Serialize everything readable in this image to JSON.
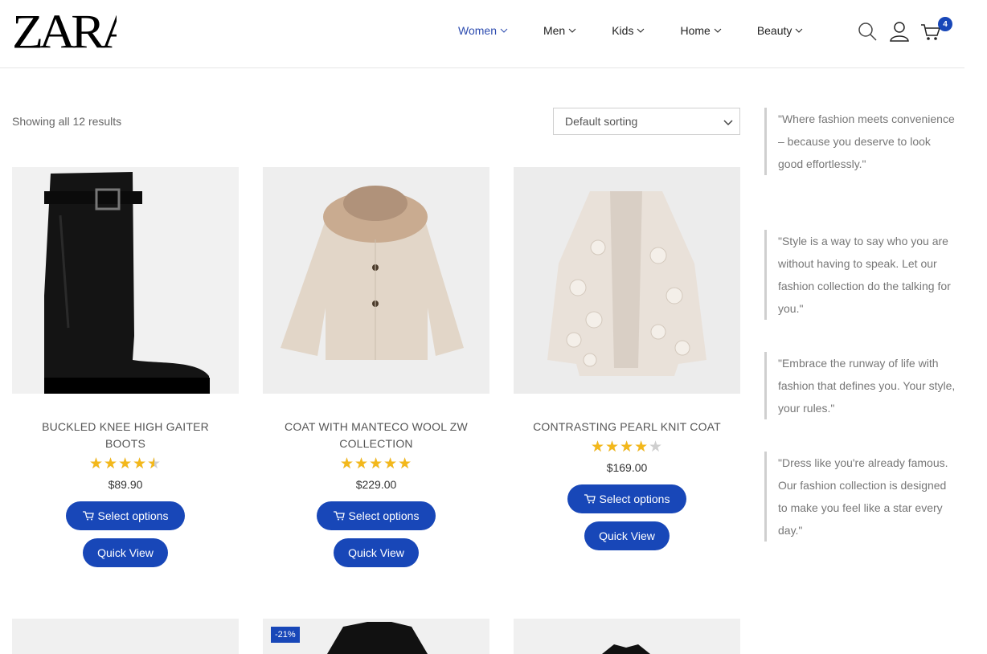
{
  "brand": {
    "logo_text": "ZARA"
  },
  "nav": {
    "items": [
      {
        "label": "Women",
        "active": true
      },
      {
        "label": "Men"
      },
      {
        "label": "Kids"
      },
      {
        "label": "Home"
      },
      {
        "label": "Beauty"
      }
    ]
  },
  "header_icons": [
    "search-icon",
    "user-icon",
    "cart-icon"
  ],
  "cart": {
    "count": "4"
  },
  "toolbar": {
    "results_text": "Showing all 12 results",
    "sort_value": "Default sorting"
  },
  "products": [
    {
      "title": "BUCKLED KNEE HIGH GAITER BOOTS",
      "rating": 4.5,
      "price": "$89.90",
      "select_label": "Select options",
      "quick_label": "Quick View",
      "image": "black-knee-high-boot"
    },
    {
      "title": "COAT WITH MANTECO WOOL ZW COLLECTION",
      "rating": 5,
      "price": "$229.00",
      "select_label": "Select options",
      "quick_label": "Quick View",
      "image": "beige-coat-fur-collar"
    },
    {
      "title": "CONTRASTING PEARL KNIT COAT",
      "rating": 4,
      "price": "$169.00",
      "select_label": "Select options",
      "quick_label": "Quick View",
      "image": "floral-knit-cardigan"
    }
  ],
  "row2": [
    {
      "badge": ""
    },
    {
      "badge": "-21%"
    },
    {
      "badge": ""
    }
  ],
  "quotes": [
    "\"Where fashion meets convenience – because you deserve to look good effortlessly.\"",
    "\"Style is a way to say who you are without having to speak. Let our fashion collection do the talking for you.\"",
    "\"Embrace the runway of life with fashion that defines you. Your style, your rules.\"",
    "\"Dress like you're already famous. Our fashion collection is designed to make you feel like a star every day.\""
  ],
  "colors": {
    "accent": "#1847b8",
    "star": "#f3b81b",
    "nav_active": "#2d4cb0"
  }
}
